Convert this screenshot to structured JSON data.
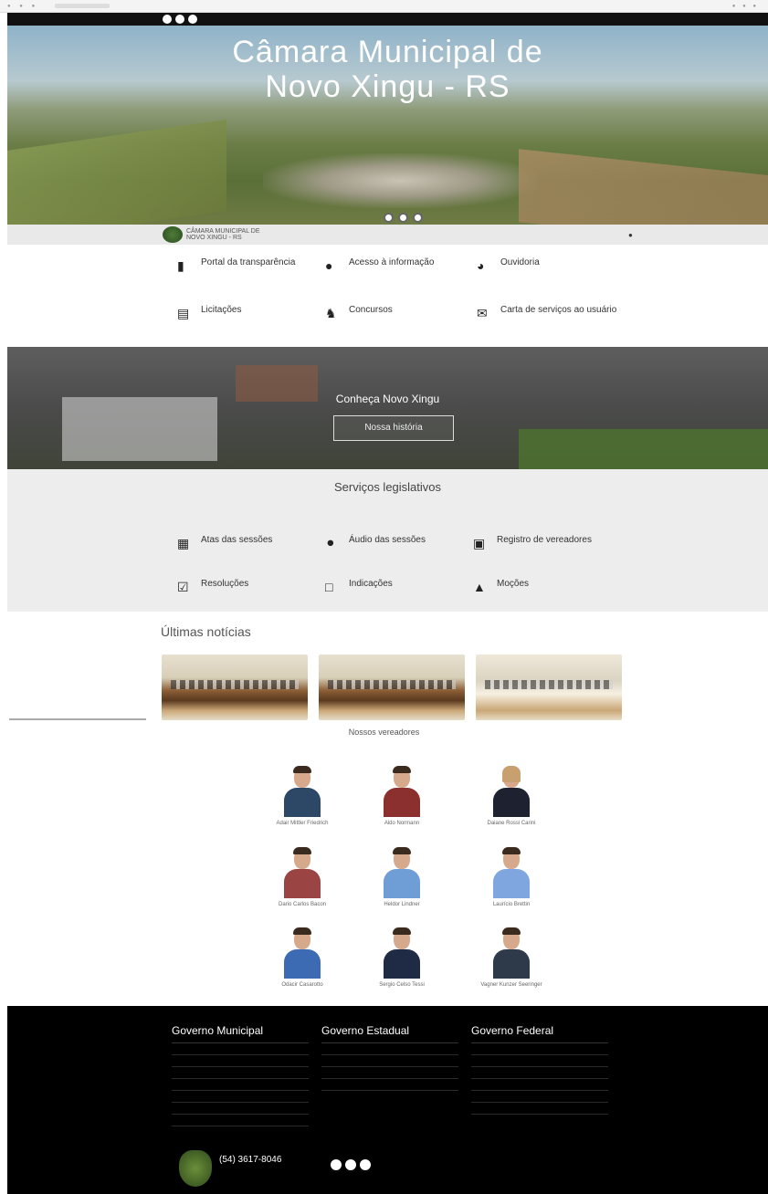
{
  "hero": {
    "title_line1": "Câmara Municipal de",
    "title_line2": "Novo Xingu - RS"
  },
  "navbar": {
    "brand_line1": "CÂMARA MUNICIPAL DE",
    "brand_line2": "NOVO XINGU - RS",
    "search_icon": "search-icon"
  },
  "services": [
    {
      "title": "Portal da transparência",
      "icon": "document-icon"
    },
    {
      "title": "Acesso à informação",
      "icon": "info-icon"
    },
    {
      "title": "Ouvidoria",
      "icon": "headset-icon"
    },
    {
      "title": "Licitações",
      "icon": "list-icon"
    },
    {
      "title": "Concursos",
      "icon": "people-icon"
    },
    {
      "title": "Carta de serviços ao usuário",
      "icon": "mail-icon"
    }
  ],
  "conheca": {
    "title": "Conheça Novo Xingu",
    "button": "Nossa história"
  },
  "legislative": {
    "title": "Serviços legislativos",
    "items": [
      {
        "title": "Atas das sessões",
        "icon": "book-icon"
      },
      {
        "title": "Áudio das sessões",
        "icon": "microphone-icon"
      },
      {
        "title": "Registro de vereadores",
        "icon": "register-icon"
      },
      {
        "title": "Resoluções",
        "icon": "calendar-check-icon"
      },
      {
        "title": "Indicações",
        "icon": "calendar-icon"
      },
      {
        "title": "Moções",
        "icon": "institution-icon"
      }
    ]
  },
  "news": {
    "title": "Últimas notícias"
  },
  "council": {
    "title": "Nossos vereadores",
    "members": [
      {
        "name": "Adair Mittler Friedrich",
        "shirt": "#2d4766"
      },
      {
        "name": "Aldo Normann",
        "shirt": "#8b2f2f"
      },
      {
        "name": "Daiane Rossi Carini",
        "shirt": "#1e2230"
      },
      {
        "name": "Dario Carlos Bacon",
        "shirt": "#9a4444"
      },
      {
        "name": "Heldor Lindner",
        "shirt": "#6f9dd6"
      },
      {
        "name": "Laurício Brettin",
        "shirt": "#7fa6de"
      },
      {
        "name": "Odacir Casarotto",
        "shirt": "#3c6bb3"
      },
      {
        "name": "Sergio Celso Tessi",
        "shirt": "#1f2a44"
      },
      {
        "name": "Vagner Kunzer Seeringer",
        "shirt": "#2e3a4a"
      }
    ]
  },
  "footer": {
    "col1": {
      "title": "Governo Municipal"
    },
    "col2": {
      "title": "Governo Estadual"
    },
    "col3": {
      "title": "Governo Federal"
    },
    "phone": "(54) 3617-8046",
    "social_icons": [
      "facebook-icon",
      "youtube-icon",
      "instagram-icon"
    ]
  }
}
